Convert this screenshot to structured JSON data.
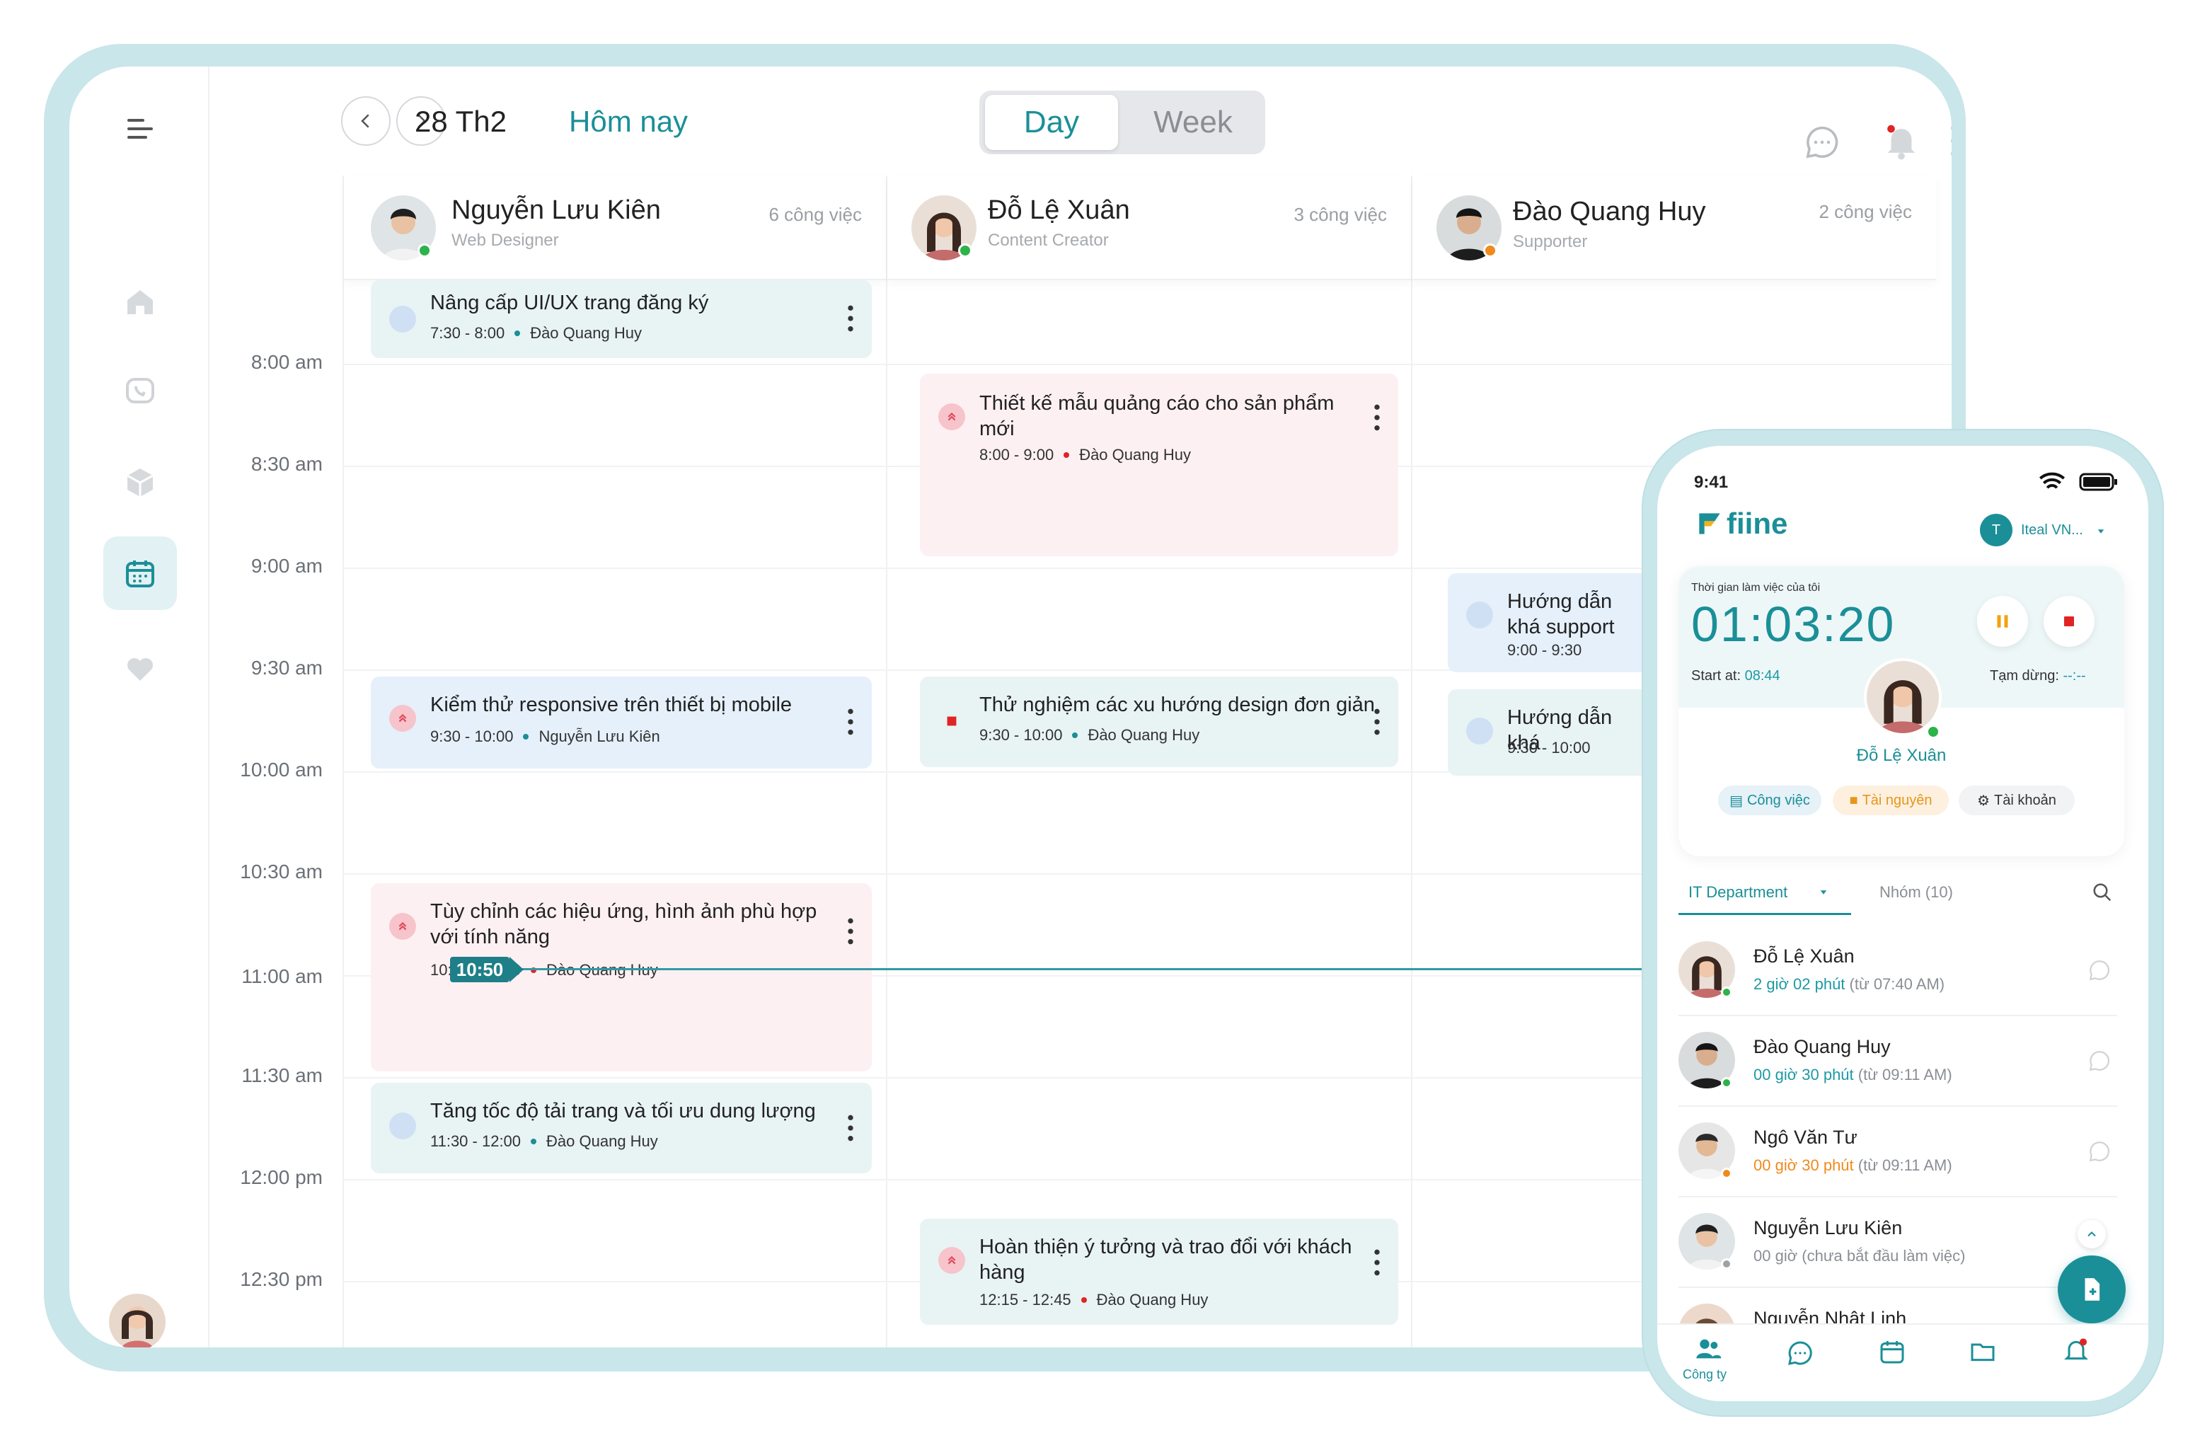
{
  "calendar": {
    "date": "28 Th2",
    "today_label": "Hôm nay",
    "view_day": "Day",
    "view_week": "Week",
    "now_time": "10:50",
    "time_labels": [
      "8:00 am",
      "8:30 am",
      "9:00 am",
      "9:30 am",
      "10:00 am",
      "10:30 am",
      "11:00 am",
      "11:30 am",
      "12:00 pm",
      "12:30 pm"
    ],
    "people": [
      {
        "name": "Nguyễn Lưu Kiên",
        "role": "Web Designer",
        "count": "6 công việc",
        "status_color": "#2cb34a"
      },
      {
        "name": "Đỗ Lệ Xuân",
        "role": "Content Creator",
        "count": "3 công việc",
        "status_color": "#2cb34a"
      },
      {
        "name": "Đào Quang Huy",
        "role": "Supporter",
        "count": "2 công việc",
        "status_color": "#f08a1c"
      }
    ],
    "events": [
      {
        "title": "Nâng cấp UI/UX trang đăng ký",
        "time": "7:30 - 8:00",
        "assignee": "Đào Quang Huy",
        "priority": "low"
      },
      {
        "title": "Thiết kế mẫu quảng cáo cho sản phẩm mới",
        "time": "8:00 - 9:00",
        "assignee": "Đào Quang Huy",
        "priority": "high"
      },
      {
        "title": "Hướng dẫn khá support",
        "time": "9:00 - 9:30",
        "assignee": "",
        "priority": "low"
      },
      {
        "title": "Kiểm thử responsive trên thiết bị mobile",
        "time": "9:30 - 10:00",
        "assignee": "Nguyễn Lưu Kiên",
        "priority": "high"
      },
      {
        "title": "Thử nghiệm các xu hướng design đơn giản",
        "time": "9:30 - 10:00",
        "assignee": "Đào Quang Huy",
        "priority": "urgent"
      },
      {
        "title": "Hướng dẫn khá",
        "time": "9:30 - 10:00",
        "assignee": "",
        "priority": "low"
      },
      {
        "title": "Tùy chỉnh các hiệu ứng, hình ảnh phù hợp với tính năng",
        "time": "10:30 - 11:20",
        "assignee": "Đào Quang Huy",
        "priority": "high"
      },
      {
        "title": "Tăng tốc độ tải trang và tối ưu dung lượng",
        "time": "11:30 - 12:00",
        "assignee": "Đào Quang Huy",
        "priority": "low"
      },
      {
        "title": "Hoàn thiện ý tưởng và trao đổi với khách hàng",
        "time": "12:15 - 12:45",
        "assignee": "Đào Quang Huy",
        "priority": "high"
      }
    ]
  },
  "phone": {
    "status_time": "9:41",
    "brand": "fiine",
    "org_initial": "T",
    "org_name": "Iteal VN...",
    "timer_caption": "Thời gian làm việc của tôi",
    "timer": "01:03:20",
    "start_label": "Start at:",
    "start_time": "08:44",
    "pause_label": "Tạm dừng:",
    "pause_value": "--:--",
    "user_name": "Đỗ Lệ Xuân",
    "pills": [
      "Công việc",
      "Tài nguyên",
      "Tài khoản"
    ],
    "dept": "IT Department",
    "group": "Nhóm (10)",
    "employees": [
      {
        "name": "Đỗ Lệ Xuân",
        "hours": "2 giờ 02 phút",
        "since": "(từ 07:40 AM)",
        "color": "#1b9aa4"
      },
      {
        "name": "Đào Quang Huy",
        "hours": "00 giờ 30 phút",
        "since": "(từ 09:11 AM)",
        "color": "#1b9aa4"
      },
      {
        "name": "Ngô Văn Tư",
        "hours": "00 giờ 30 phút",
        "since": "(từ 09:11 AM)",
        "color": "#f08a1c"
      },
      {
        "name": "Nguyễn Lưu Kiên",
        "hours": "00 giờ",
        "since": "(chưa bắt đầu làm việc)",
        "color": "#8a8e94"
      },
      {
        "name": "Nguyễn Nhật Linh",
        "hours": "",
        "since": "",
        "color": "#8a8e94"
      }
    ],
    "tab_company": "Công ty"
  }
}
